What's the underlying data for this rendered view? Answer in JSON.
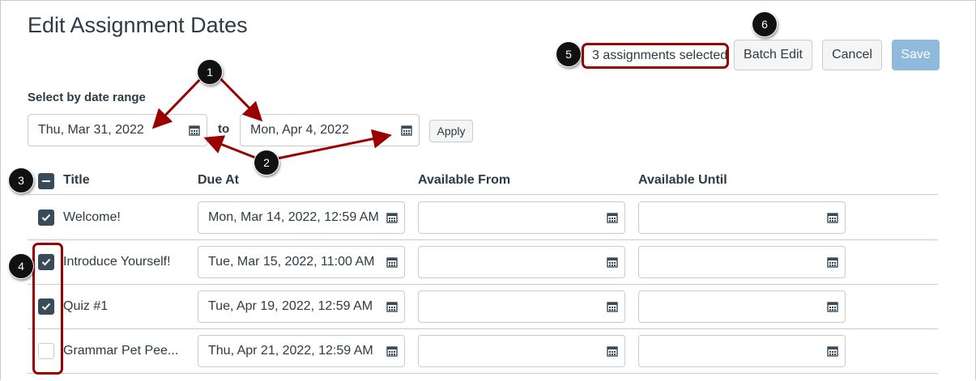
{
  "page_title": "Edit Assignment Dates",
  "selected_count": "3 assignments selected",
  "buttons": {
    "batch_edit": "Batch Edit",
    "cancel": "Cancel",
    "save": "Save",
    "apply": "Apply"
  },
  "date_range": {
    "label": "Select by date range",
    "start": "Thu, Mar 31, 2022",
    "to": "to",
    "end": "Mon, Apr 4, 2022"
  },
  "columns": [
    "Title",
    "Due At",
    "Available From",
    "Available Until"
  ],
  "rows": [
    {
      "title": "Welcome!",
      "due": "Mon, Mar 14, 2022, 12:59 AM",
      "from": "",
      "until": "",
      "checked": true
    },
    {
      "title": "Introduce Yourself!",
      "due": "Tue, Mar 15, 2022, 11:00 AM",
      "from": "",
      "until": "",
      "checked": true
    },
    {
      "title": "Quiz #1",
      "due": "Tue, Apr 19, 2022, 12:59 AM",
      "from": "",
      "until": "",
      "checked": true
    },
    {
      "title": "Grammar Pet Pee...",
      "due": "Thu, Apr 21, 2022, 12:59 AM",
      "from": "",
      "until": "",
      "checked": false
    }
  ],
  "annotations": [
    "1",
    "2",
    "3",
    "4",
    "5",
    "6"
  ],
  "colors": {
    "annotation_red": "#990000",
    "save_disabled": "#8fbadb",
    "checkbox": "#394b58"
  }
}
